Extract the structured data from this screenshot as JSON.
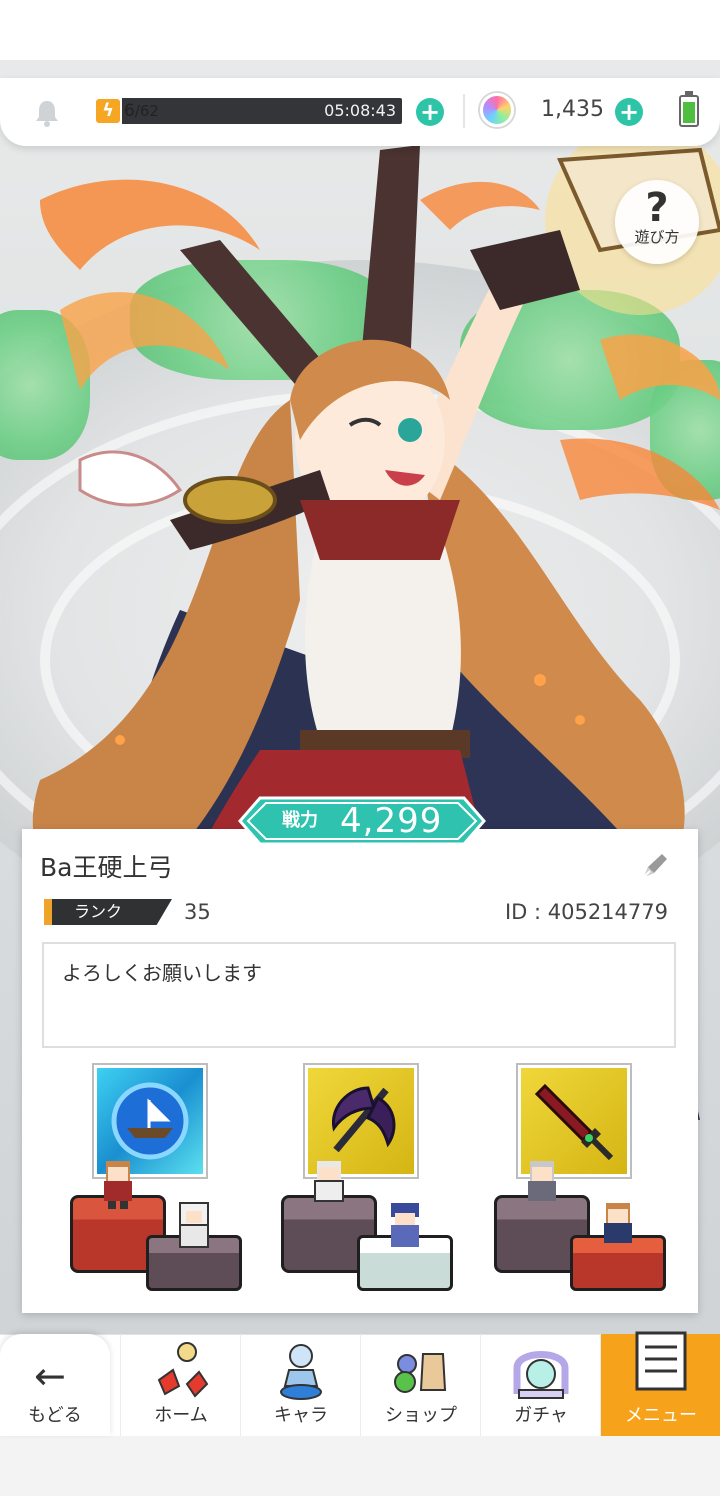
{
  "status_bar": {
    "stamina_current": "6",
    "stamina_max": "/62",
    "stamina_fraction": 0.097,
    "stamina_timer": "05:08:43",
    "gem_count": "1,435",
    "battery_fraction": 0.9
  },
  "help": {
    "label": "遊び方"
  },
  "profile": {
    "power_label": "戦力",
    "power_value": "4,299",
    "name": "Ba王硬上弓",
    "rank_label": "ランク",
    "rank_value": "35",
    "player_id": "ID : 405214779",
    "comment": "よろしくお願いします"
  },
  "teams": [
    {
      "weapon_icon": "ship-orb-icon",
      "weapon_bg": "#38b6e8"
    },
    {
      "weapon_icon": "axe-icon",
      "weapon_bg": "#e4c21a"
    },
    {
      "weapon_icon": "sword-icon",
      "weapon_bg": "#e4c21a"
    }
  ],
  "nav": {
    "back_label": "もどる",
    "tabs": [
      {
        "label": "ホーム",
        "icon": "home-icon"
      },
      {
        "label": "キャラ",
        "icon": "character-icon"
      },
      {
        "label": "ショップ",
        "icon": "shop-icon"
      },
      {
        "label": "ガチャ",
        "icon": "gacha-icon"
      },
      {
        "label": "メニュー",
        "icon": "menu-icon"
      }
    ],
    "active_tab": "メニュー"
  },
  "colors": {
    "accent": "#2ec4a8",
    "active_tab": "#f7a21b",
    "rank_tag": "#2f3133",
    "rank_stripe": "#f0a32a"
  }
}
